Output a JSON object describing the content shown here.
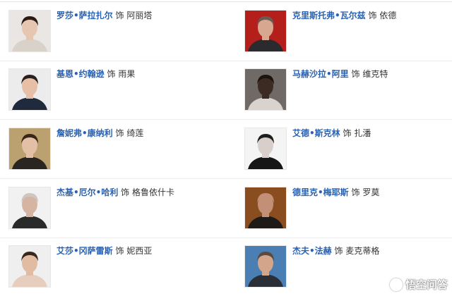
{
  "cast": [
    {
      "actor": "罗莎•萨拉扎尔",
      "sep": "饰",
      "role": "阿丽塔",
      "bg": "#e9e6e3",
      "skin": "#e7c6b1",
      "hair": "#2a1a14",
      "shirt": "#d9d2cb"
    },
    {
      "actor": "克里斯托弗•瓦尔兹",
      "sep": "饰",
      "role": "依德",
      "bg": "#b51f1b",
      "skin": "#d7a88f",
      "hair": "#6b5a4f",
      "shirt": "#2b2b2f"
    },
    {
      "actor": "基恩•约翰逊",
      "sep": "饰",
      "role": "雨果",
      "bg": "#ececec",
      "skin": "#e6bfa6",
      "hair": "#2a201b",
      "shirt": "#1f2b3d"
    },
    {
      "actor": "马赫沙拉•阿里",
      "sep": "饰",
      "role": "维克特",
      "bg": "#6f6a65",
      "skin": "#3c2b22",
      "hair": "#1a1411",
      "shirt": "#d8d3cc"
    },
    {
      "actor": "詹妮弗•康纳利",
      "sep": "饰",
      "role": "绮莲",
      "bg": "#bba070",
      "skin": "#e3c0a5",
      "hair": "#3a2618",
      "shirt": "#2b2522"
    },
    {
      "actor": "艾德•斯克林",
      "sep": "饰",
      "role": "扎潘",
      "bg": "#f4f4f4",
      "skin": "#d9cfca",
      "hair": "#1e1e1e",
      "shirt": "#161616"
    },
    {
      "actor": "杰基•厄尔•哈利",
      "sep": "饰",
      "role": "格鲁依什卡",
      "bg": "#f1f1f1",
      "skin": "#d6b4a4",
      "hair": "#cfc6c0",
      "shirt": "#2a2a2a"
    },
    {
      "actor": "德里克•梅耶斯",
      "sep": "饰",
      "role": "罗莫",
      "bg": "#8a4d1f",
      "skin": "#c39077",
      "hair": "#c39077",
      "shirt": "#1e1a17"
    },
    {
      "actor": "艾莎•冈萨雷斯",
      "sep": "饰",
      "role": "妮西亚",
      "bg": "#efefef",
      "skin": "#e2bba3",
      "hair": "#3b261b",
      "shirt": "#e7cdbd"
    },
    {
      "actor": "杰夫•法赫",
      "sep": "饰",
      "role": "麦克蒂格",
      "bg": "#4b7fb3",
      "skin": "#d3a58a",
      "hair": "#5a4a3f",
      "shirt": "#2a2e36"
    }
  ],
  "watermark": {
    "text": "悟空问答"
  }
}
